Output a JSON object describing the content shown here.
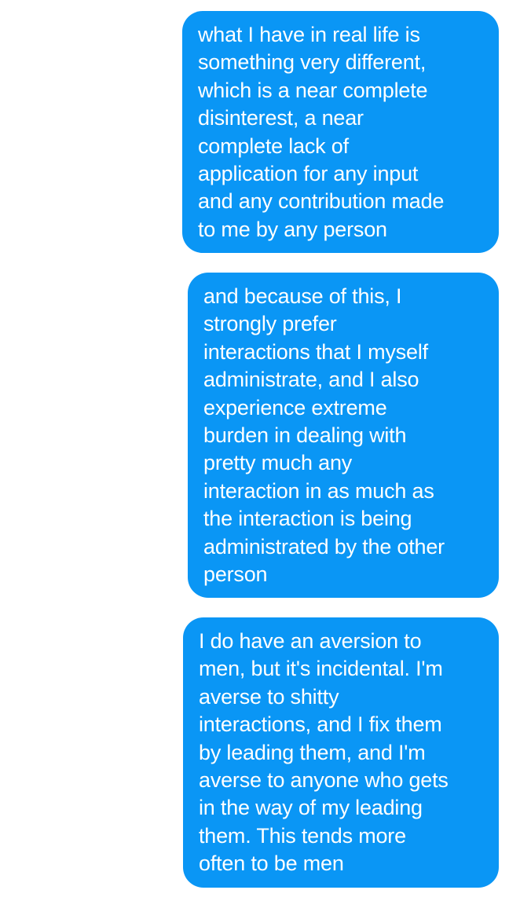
{
  "theme": {
    "bubble_color": "#0a96f5",
    "text_color": "#ffffff"
  },
  "messages": [
    {
      "lines": [
        "what I have in real life is",
        "something very different,",
        "which is a near complete",
        "disinterest, a near",
        "complete lack of",
        "application for any input",
        "and any contribution made",
        "to me by any person"
      ]
    },
    {
      "lines": [
        "and because of this, I",
        "strongly prefer",
        "interactions that I myself",
        "administrate, and I also",
        "experience extreme",
        "burden in dealing with",
        "pretty much any",
        "interaction in as much as",
        "the interaction is being",
        "administrated by the other",
        "person"
      ]
    },
    {
      "lines": [
        "I do have an aversion to",
        "men, but it's incidental. I'm",
        "averse to shitty",
        "interactions, and I fix them",
        "by leading them, and I'm",
        "averse to anyone who gets",
        "in the way of my leading",
        "them. This tends more",
        "often to be men"
      ]
    }
  ]
}
